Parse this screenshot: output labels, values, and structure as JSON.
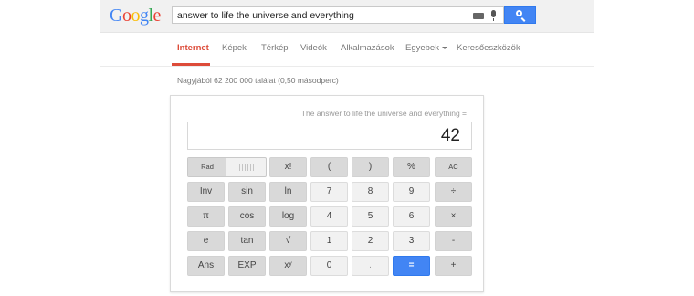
{
  "logo": "Google",
  "search": {
    "query": "answer to life the universe and everything"
  },
  "tabs": [
    {
      "label": "Internet",
      "active": true
    },
    {
      "label": "Képek"
    },
    {
      "label": "Térkép"
    },
    {
      "label": "Videók"
    },
    {
      "label": "Alkalmazások"
    },
    {
      "label": "Egyebek"
    },
    {
      "label": "Keresőeszközök"
    }
  ],
  "results_count": "Nagyjából 62 200 000 találat (0,50 másodperc)",
  "calculator": {
    "history": "The answer to life the universe and everything =",
    "display": "42",
    "rad_label": "Rad",
    "keys": {
      "fact": "x!",
      "lparen": "(",
      "rparen": ")",
      "percent": "%",
      "ac": "AC",
      "inv": "Inv",
      "sin": "sin",
      "ln": "ln",
      "d7": "7",
      "d8": "8",
      "d9": "9",
      "div": "÷",
      "pi": "π",
      "cos": "cos",
      "log": "log",
      "d4": "4",
      "d5": "5",
      "d6": "6",
      "mul": "×",
      "e": "e",
      "tan": "tan",
      "sqrt": "√",
      "d1": "1",
      "d2": "2",
      "d3": "3",
      "sub": "-",
      "ans": "Ans",
      "exp": "EXP",
      "pow": "xʸ",
      "d0": "0",
      "dot": ".",
      "eq": "=",
      "add": "+"
    }
  },
  "colors": {
    "accent": "#dd4b39",
    "search_button": "#4285f4"
  }
}
